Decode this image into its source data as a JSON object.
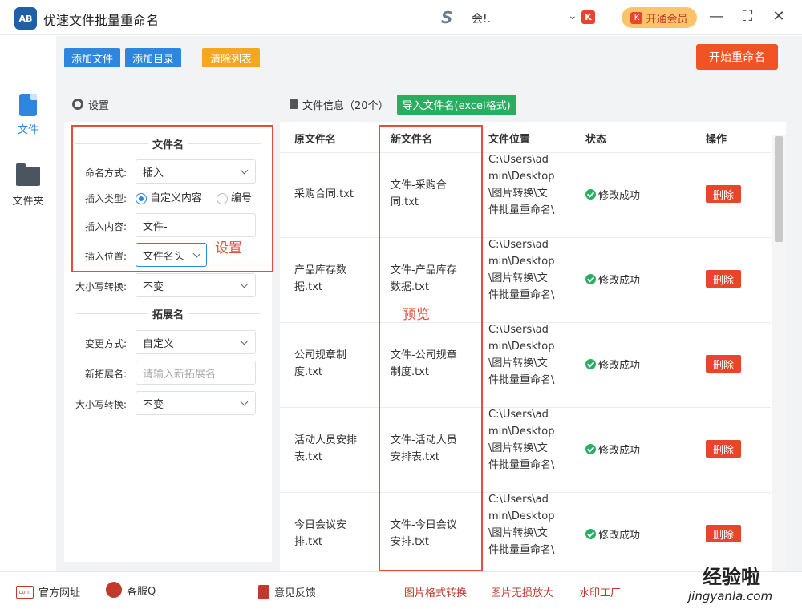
{
  "titlebar": {
    "logo_text": "AB",
    "title": "优速文件批量重命名",
    "user_name": "会!.",
    "vip_label": "开通会员",
    "minimize": "—",
    "maximize": "⛶",
    "close": "✕"
  },
  "nav": {
    "file_label": "文件",
    "folder_label": "文件夹"
  },
  "toolbar": {
    "add_file": "添加文件",
    "add_dir": "添加目录",
    "clear_list": "清除列表",
    "start": "开始重命名"
  },
  "settings": {
    "header": "设置",
    "filename_section": "文件名",
    "naming_mode_label": "命名方式:",
    "naming_mode_value": "插入",
    "insert_type_label": "插入类型:",
    "insert_type_opt1": "自定义内容",
    "insert_type_opt2": "编号",
    "insert_content_label": "插入内容:",
    "insert_content_value": "文件-",
    "insert_pos_label": "插入位置:",
    "insert_pos_value": "文件名头",
    "case_label": "大小写转换:",
    "case_value": "不变",
    "ext_section": "拓展名",
    "change_mode_label": "变更方式:",
    "change_mode_value": "自定义",
    "new_ext_label": "新拓展名:",
    "new_ext_placeholder": "请输入新拓展名",
    "ext_case_label": "大小写转换:",
    "ext_case_value": "不变"
  },
  "annotations": {
    "settings": "设置",
    "preview": "预览"
  },
  "info": {
    "header": "文件信息（20个）",
    "import_btn": "导入文件名(excel格式)",
    "columns": [
      "原文件名",
      "新文件名",
      "文件位置",
      "状态",
      "操作"
    ],
    "rows": [
      {
        "orig": "采购合同.txt",
        "new": "文件-采购合同.txt",
        "path": "C:\\Users\\admin\\Desktop\\图片转换\\文件批量重命名\\",
        "status": "修改成功",
        "action": "删除"
      },
      {
        "orig": "产品库存数据.txt",
        "new": "文件-产品库存数据.txt",
        "path": "C:\\Users\\admin\\Desktop\\图片转换\\文件批量重命名\\",
        "status": "修改成功",
        "action": "删除"
      },
      {
        "orig": "公司规章制度.txt",
        "new": "文件-公司规章制度.txt",
        "path": "C:\\Users\\admin\\Desktop\\图片转换\\文件批量重命名\\",
        "status": "修改成功",
        "action": "删除"
      },
      {
        "orig": "活动人员安排表.txt",
        "new": "文件-活动人员安排表.txt",
        "path": "C:\\Users\\admin\\Desktop\\图片转换\\文件批量重命名\\",
        "status": "修改成功",
        "action": "删除"
      },
      {
        "orig": "今日会议安排.txt",
        "new": "文件-今日会议安排.txt",
        "path": "C:\\Users\\admin\\Desktop\\图片转换\\文件批量重命名\\",
        "status": "修改成功",
        "action": "删除"
      }
    ]
  },
  "footer": {
    "website": "官方网址",
    "service": "客服Q",
    "feedback": "意见反馈",
    "img_convert": "图片格式转换",
    "img_enlarge": "图片无损放大",
    "watermark": "水印工厂",
    "wm_brand": "经验啦",
    "wm_url": "jingyanla.com"
  }
}
